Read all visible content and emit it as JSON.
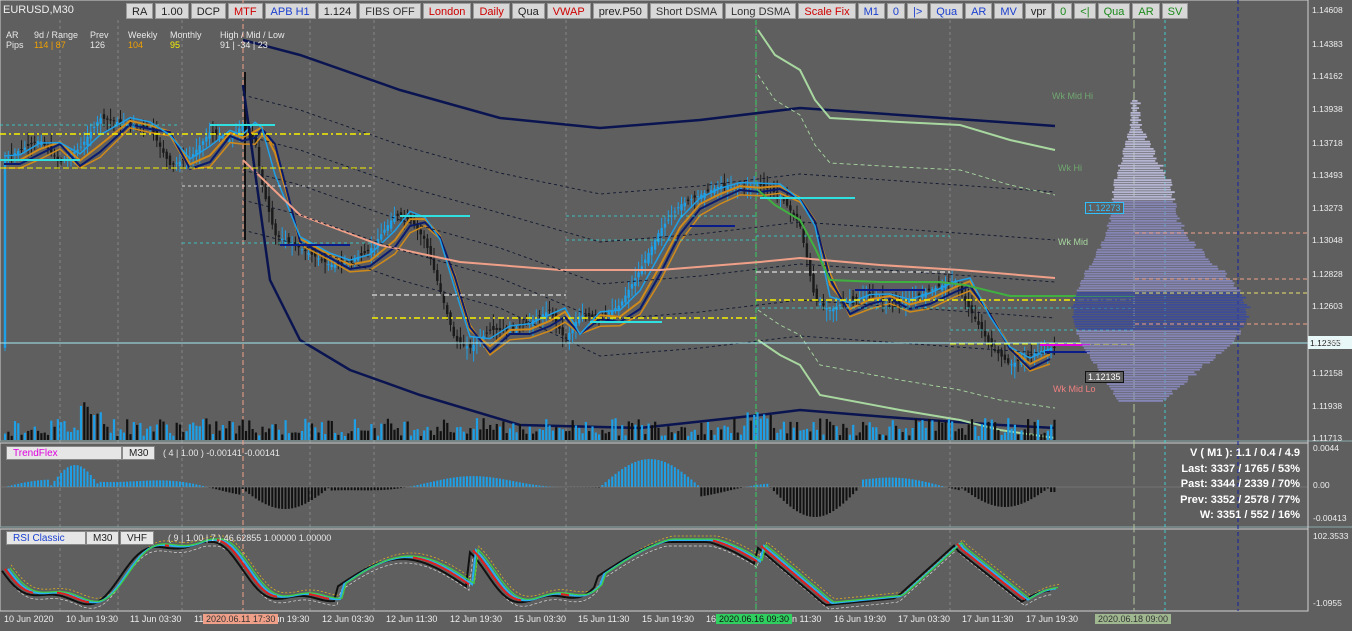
{
  "symbol": "EURUSD,M30",
  "toolbar": [
    "RA",
    "1.00",
    "DCP",
    "MTF",
    "APB H1",
    "1.124",
    "FIBS OFF",
    "London",
    "Daily",
    "Qua",
    "VWAP",
    "prev.P50",
    "Short DSMA",
    "Long DSMA",
    "Scale Fix",
    "M1",
    "0",
    "|>",
    "Qua",
    "AR",
    "MV",
    "vpr",
    "0",
    "<|",
    "Qua",
    "AR",
    "SV"
  ],
  "toolbar_colors": [
    "#222",
    "#222",
    "#222",
    "#d00000",
    "#1a3fd0",
    "#222",
    "#333",
    "#d00000",
    "#d00000",
    "#222",
    "#d00000",
    "#222",
    "#333",
    "#333",
    "#d00000",
    "#1a3fd0",
    "#1a3fd0",
    "#1a3fd0",
    "#1a3fd0",
    "#1a3fd0",
    "#1a3fd0",
    "#222",
    "#1a8a1a",
    "#1a8a1a",
    "#1a8a1a",
    "#1a8a1a",
    "#1a8a1a"
  ],
  "info": {
    "row1": [
      "AR",
      "9d / Range",
      "Prev",
      "Weekly",
      "Monthly",
      "High / Mid / Low"
    ],
    "row2_label": "Pips",
    "range": "114 | 87",
    "prev": "126",
    "weekly": "104",
    "monthly": "95",
    "hml": "91  |  -34  |  23"
  },
  "price_scale": [
    "1.14608",
    "1.14383",
    "1.14162",
    "1.13938",
    "1.13718",
    "1.13493",
    "1.13273",
    "1.13048",
    "1.12828",
    "1.12603",
    "1.12365",
    "1.12158",
    "1.11938",
    "1.11713"
  ],
  "current_price": "1.12365",
  "boxes": {
    "upper": "1.12273",
    "lower": "1.12135"
  },
  "chart_labels": {
    "wk_mid": "Wk Mid",
    "wk_mid_lo": "Wk Mid Lo",
    "wk_hi": "Wk Hi",
    "wk_mid_hi": "Wk Mid Hi"
  },
  "trendflex": {
    "label": "TrendFlex",
    "tf": "M30",
    "params": "( 4 | 1.00 )  -0.00141  -0.00141",
    "scale": [
      "0.0044",
      "0.00",
      "-0.00413"
    ]
  },
  "rsi": {
    "label": "RSI Classic",
    "tf": "M30",
    "vhf": "VHF",
    "params": "( 9 | 1.00 | 7 )  46.62855  1.00000  1.00000",
    "scale": [
      "102.3533",
      "-1.0955"
    ]
  },
  "stats": [
    "V ( M1 ): 1.1 / 0.4 / 4.9",
    "Last: 3337 / 1765 / 53%",
    "Past: 3344 / 2339 / 70%",
    "Prev: 3352 / 2578 / 77%",
    "W: 3351 / 552 / 16%"
  ],
  "time_labels": [
    "10 Jun 2020",
    "10 Jun 19:30",
    "11 Jun 03:30",
    "11 Jun 11:30",
    "11 Jun 19:30",
    "12 Jun 03:30",
    "12 Jun 11:30",
    "12 Jun 19:30",
    "15 Jun 03:30",
    "15 Jun 11:30",
    "15 Jun 19:30",
    "16 Jun 03:30",
    "16 Jun 11:30",
    "16 Jun 19:30",
    "17 Jun 03:30",
    "17 Jun 11:30",
    "17 Jun 19:30"
  ],
  "time_badges": {
    "a": "2020.06.11 17:30",
    "b": "2020.06.16 09:30",
    "c": "2020.06.18 09:00"
  },
  "colors": {
    "bg": "#5f5f5f",
    "bull": "#1e9fe6",
    "bear": "#1a1a1a",
    "ma_orange": "#d08a1a",
    "ma_blue": "#0a1b6e",
    "salmon": "#f0a088",
    "green": "#40b040",
    "lightgreen": "#a8d8a0",
    "cyan": "#3ee8f0"
  }
}
